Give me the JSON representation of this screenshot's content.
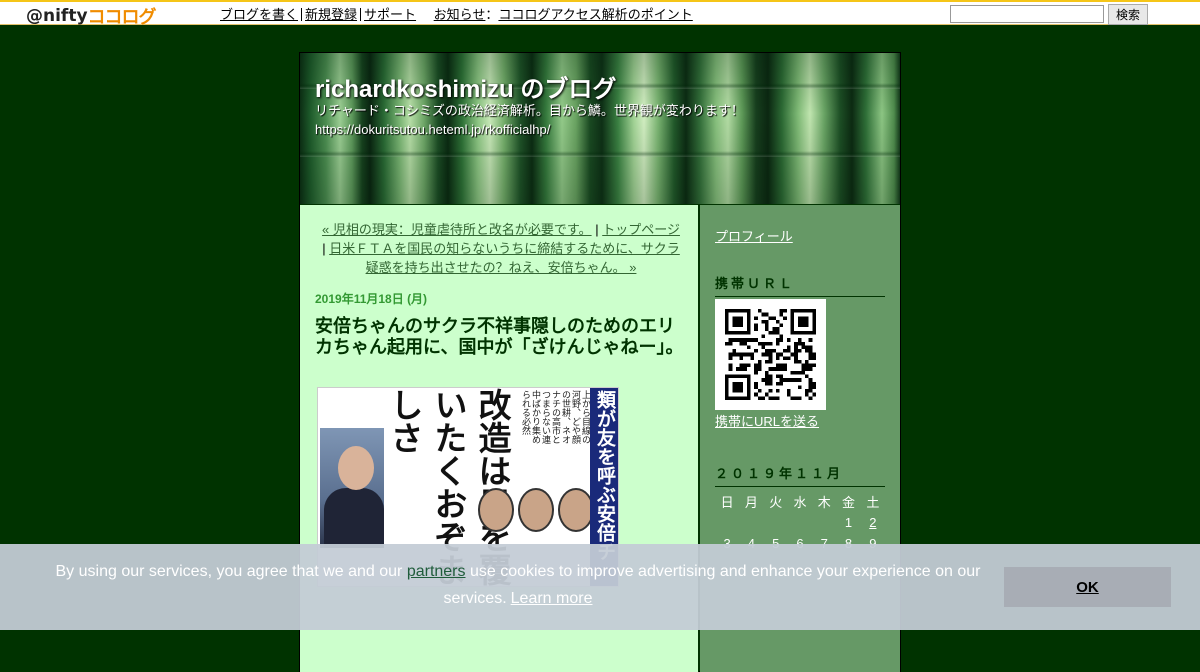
{
  "topbar": {
    "logo_prefix": "@nifty",
    "logo_brand": "ココログ",
    "links": [
      "ブログを書く",
      "新規登録",
      "サポート"
    ],
    "notice_label": "お知らせ",
    "notice_colon": "：",
    "notice_link": "ココログアクセス解析のポイント",
    "search_value": "",
    "search_button": "検索"
  },
  "blog": {
    "title": "richardkoshimizu のブログ",
    "description": "リチャード・コシミズの政治経済解析。目から鱗。世界観が変わります！",
    "url": "https://dokuritsutou.heteml.jp/rkofficialhp/"
  },
  "entry": {
    "nav_prev": "« 児相の現実：児童虐待所と改名が必要です。",
    "nav_sep1": " | ",
    "nav_top": "トップページ",
    "nav_sep2": " | ",
    "nav_next": "日米ＦＴＡを国民の知らないうちに締結するために、サクラ疑惑を持ち出させたの？ねえ、安倍ちゃん。 »",
    "date": "2019年11月18日 (月)",
    "title": "安倍ちゃんのサクラ不祥事隠しのためのエリカちゃん起用に、国中が「ざけんじゃねー」。",
    "image_headline_vertical": "類が友を呼ぶ安倍チ",
    "image_headline_big": "改造は目を覆いたくおぞましさ",
    "image_small_text": "上から目線の河野、どや顔の世耕、ネオナチの高市とつまらない連中ばかり集められる必然"
  },
  "sidebar": {
    "profile": "プロフィール",
    "mobile_heading": "携帯ＵＲＬ",
    "mobile_link": "携帯にURLを送る",
    "calendar_heading": "２０１９年１１月",
    "weekdays": [
      "日",
      "月",
      "火",
      "水",
      "木",
      "金",
      "土"
    ],
    "week1": [
      "",
      "",
      "",
      "",
      "",
      "1",
      "2"
    ],
    "week2": [
      "3",
      "4",
      "5",
      "6",
      "7",
      "8",
      "9"
    ]
  },
  "cookie": {
    "text_before": "By using our services, you agree that we and our ",
    "partners": "partners",
    "text_after": " use cookies to improve advertising and enhance your experience on our services.",
    "learn_more": "Learn more",
    "ok": "OK"
  },
  "colors": {
    "page_bg": "#003300",
    "content_bg": "#ccffcc",
    "sidebar_bg": "#669966",
    "date_color": "#339933",
    "title_color": "#003300",
    "topbar_accent": "#f5c518"
  }
}
